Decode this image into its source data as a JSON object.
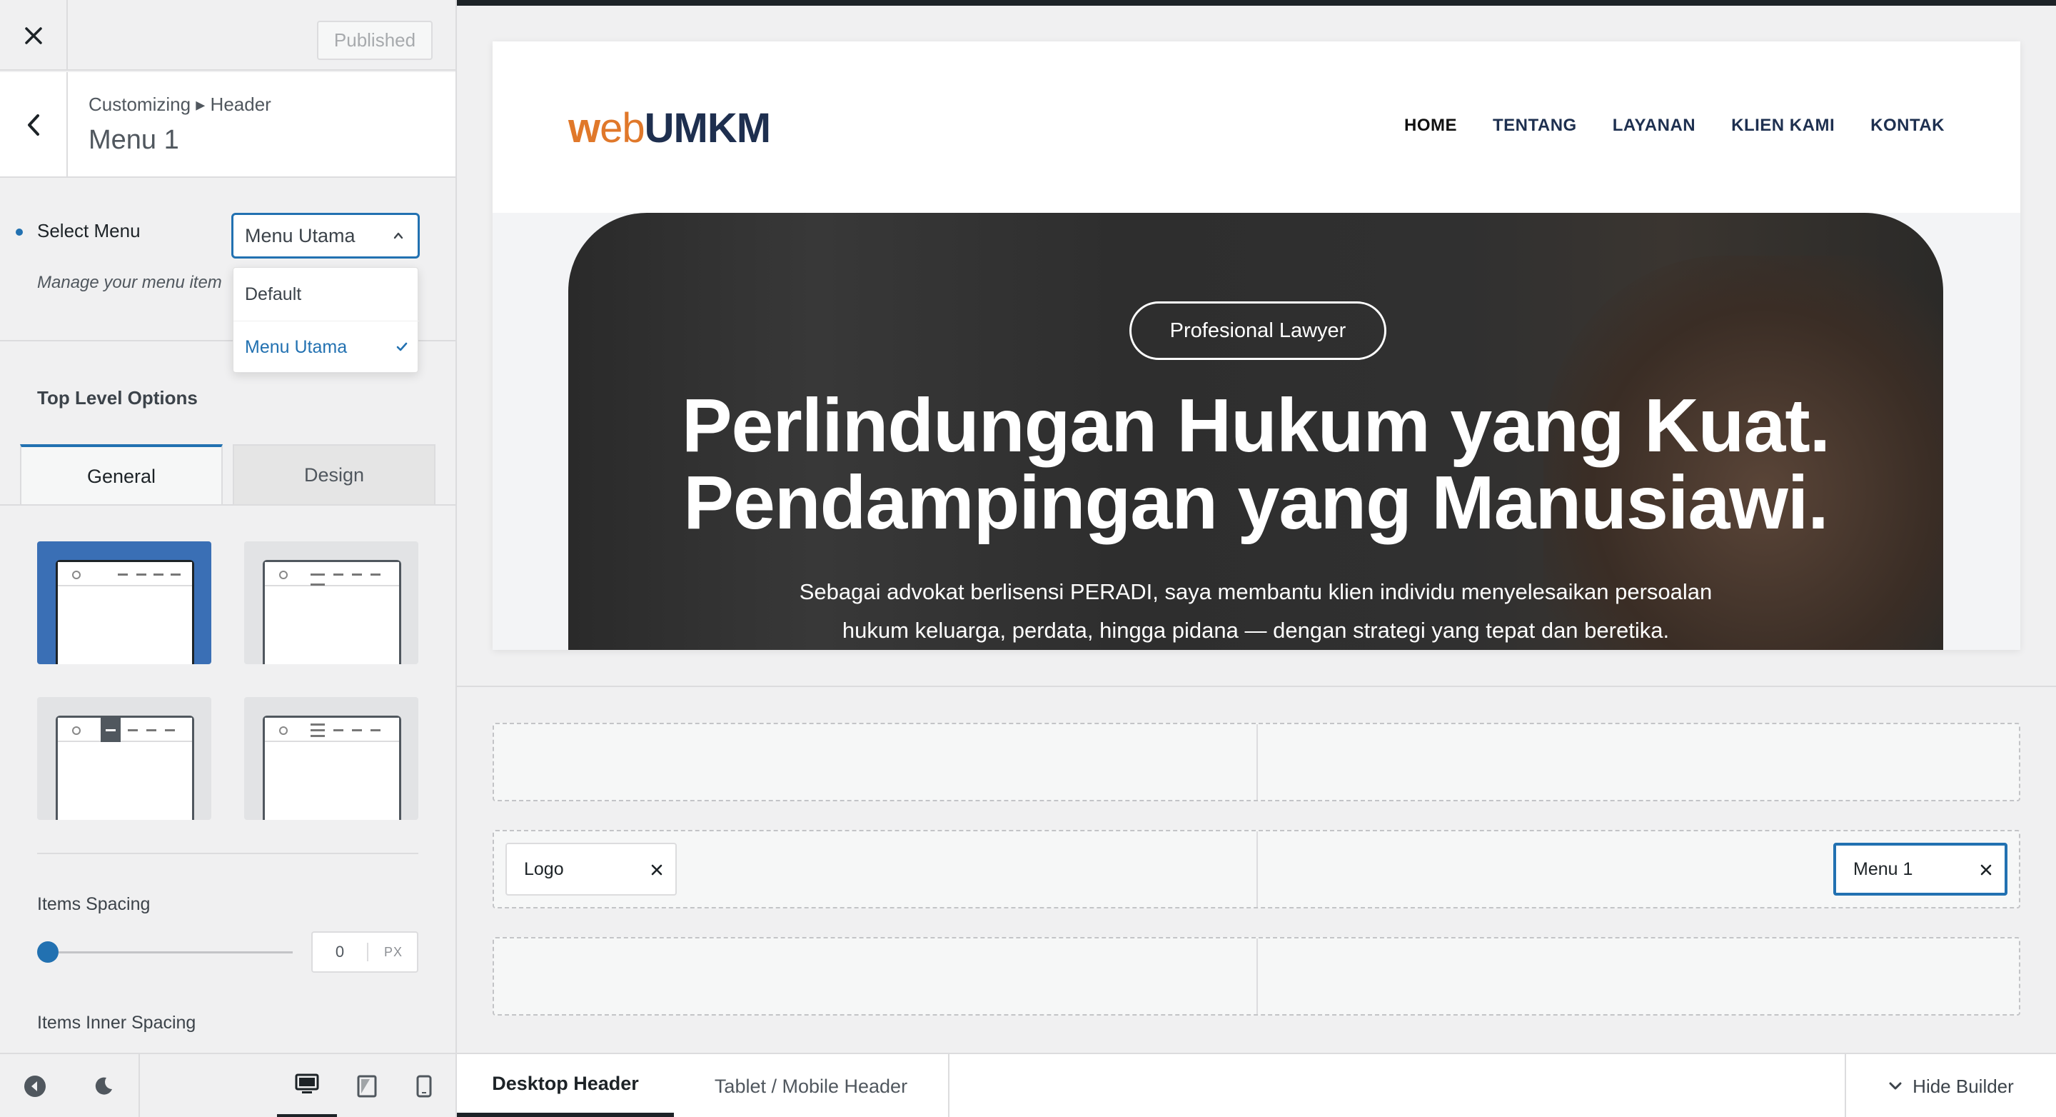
{
  "header": {
    "published_label": "Published"
  },
  "panel": {
    "breadcrumb": "Customizing ▸ Header",
    "title": "Menu 1"
  },
  "select_menu": {
    "label": "Select Menu",
    "value": "Menu Utama",
    "description": "Manage your menu item",
    "options": [
      {
        "label": "Default",
        "selected": false
      },
      {
        "label": "Menu Utama",
        "selected": true
      }
    ]
  },
  "top_level": {
    "label": "Top Level Options",
    "tabs": [
      "General",
      "Design"
    ],
    "active_tab": "General"
  },
  "items_spacing": {
    "label": "Items Spacing",
    "value": "0",
    "unit": "PX"
  },
  "items_inner_spacing": {
    "label": "Items Inner Spacing"
  },
  "site": {
    "logo": {
      "w": "w",
      "eb": "eb",
      "umkm": "UMKM"
    },
    "nav": [
      "HOME",
      "TENTANG",
      "LAYANAN",
      "KLIEN KAMI",
      "KONTAK"
    ],
    "badge": "Profesional Lawyer",
    "headline_1": "Perlindungan Hukum yang Kuat.",
    "headline_2": "Pendampingan yang Manusiawi.",
    "paragraph_1": "Sebagai advokat berlisensi PERADI, saya membantu klien individu menyelesaikan persoalan",
    "paragraph_2": "hukum keluarga, perdata, hingga pidana — dengan strategi yang tepat dan beretika."
  },
  "builder": {
    "logo_chip": "Logo",
    "menu_chip": "Menu 1",
    "tabs": [
      "Desktop Header",
      "Tablet / Mobile Header"
    ],
    "hide_builder": "Hide Builder"
  },
  "colors": {
    "accent": "#2271b1",
    "logo_orange": "#e0782a",
    "logo_navy": "#1e2f4f"
  }
}
